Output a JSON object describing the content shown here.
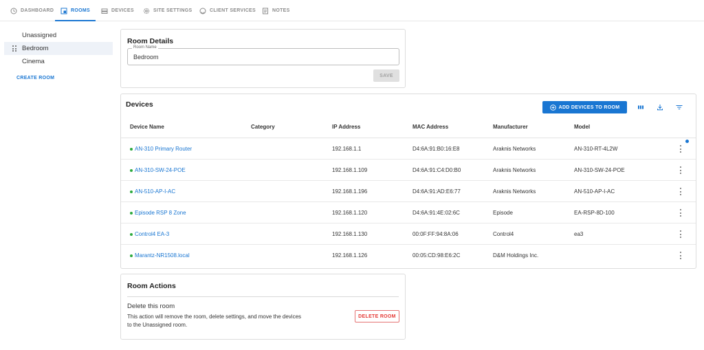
{
  "colors": {
    "accent": "#1976d2",
    "status_online": "#2eaa3e",
    "danger": "#e53935"
  },
  "tabs": [
    {
      "label": "DASHBOARD",
      "icon": "clock-icon"
    },
    {
      "label": "ROOMS",
      "icon": "room-icon",
      "active": true
    },
    {
      "label": "DEVICES",
      "icon": "devices-icon"
    },
    {
      "label": "SITE SETTINGS",
      "icon": "gear-icon"
    },
    {
      "label": "CLIENT SERVICES",
      "icon": "headset-icon"
    },
    {
      "label": "NOTES",
      "icon": "notes-icon"
    }
  ],
  "sidebar": {
    "items": [
      {
        "label": "Unassigned"
      },
      {
        "label": "Bedroom",
        "selected": true
      },
      {
        "label": "Cinema"
      }
    ],
    "create_label": "CREATE ROOM"
  },
  "room_details": {
    "title": "Room Details",
    "field_label": "Room Name",
    "field_value": "Bedroom",
    "save_label": "SAVE"
  },
  "devices": {
    "title": "Devices",
    "add_label": "ADD DEVICES TO ROOM",
    "columns": [
      "Device Name",
      "Category",
      "IP Address",
      "MAC Address",
      "Manufacturer",
      "Model"
    ],
    "rows": [
      {
        "name": "AN-310 Primary Router",
        "category": "",
        "ip": "192.168.1.1",
        "mac": "D4:6A:91:B0:16:E8",
        "manufacturer": "Araknis Networks",
        "model": "AN-310-RT-4L2W"
      },
      {
        "name": "AN-310-SW-24-POE",
        "category": "",
        "ip": "192.168.1.109",
        "mac": "D4:6A:91:C4:D0:B0",
        "manufacturer": "Araknis Networks",
        "model": "AN-310-SW-24-POE"
      },
      {
        "name": "AN-510-AP-I-AC",
        "category": "",
        "ip": "192.168.1.196",
        "mac": "D4:6A:91:AD:E6:77",
        "manufacturer": "Araknis Networks",
        "model": "AN-510-AP-I-AC"
      },
      {
        "name": "Episode RSP 8 Zone",
        "category": "",
        "ip": "192.168.1.120",
        "mac": "D4:6A:91:4E:02:6C",
        "manufacturer": "Episode",
        "model": "EA-RSP-8D-100"
      },
      {
        "name": "Control4 EA-3",
        "category": "",
        "ip": "192.168.1.130",
        "mac": "00:0F:FF:94:8A:06",
        "manufacturer": "Control4",
        "model": "ea3"
      },
      {
        "name": "Marantz-NR1508.local",
        "category": "",
        "ip": "192.168.1.126",
        "mac": "00:05:CD:98:E6:2C",
        "manufacturer": "D&M Holdings Inc.",
        "model": ""
      }
    ]
  },
  "room_actions": {
    "title": "Room Actions",
    "delete_title": "Delete this room",
    "delete_text": "This action will remove the room, delete settings, and move the devices to the Unassigned room.",
    "delete_label": "DELETE ROOM"
  }
}
